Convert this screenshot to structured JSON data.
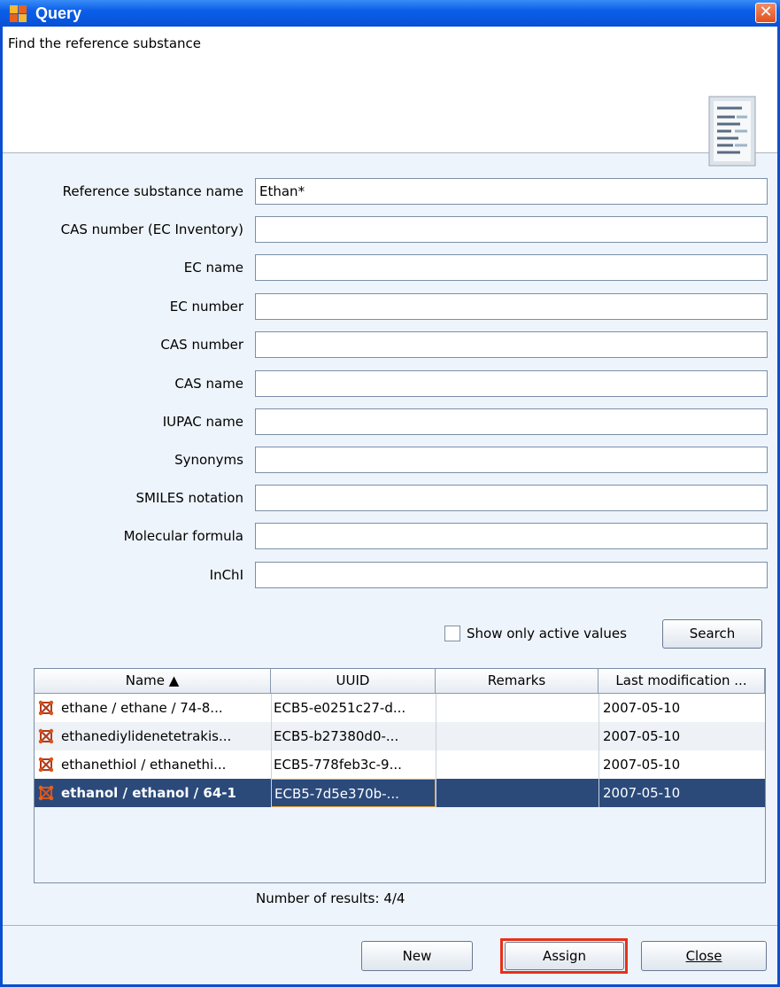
{
  "window": {
    "title": "Query",
    "close_label": "✕"
  },
  "header": {
    "text": "Find the reference substance"
  },
  "form": {
    "fields": [
      {
        "label": "Reference substance name",
        "value": "Ethan*"
      },
      {
        "label": "CAS number (EC Inventory)",
        "value": ""
      },
      {
        "label": "EC name",
        "value": ""
      },
      {
        "label": "EC number",
        "value": ""
      },
      {
        "label": "CAS number",
        "value": ""
      },
      {
        "label": "CAS name",
        "value": ""
      },
      {
        "label": "IUPAC name",
        "value": ""
      },
      {
        "label": "Synonyms",
        "value": ""
      },
      {
        "label": "SMILES notation",
        "value": ""
      },
      {
        "label": "Molecular formula",
        "value": ""
      },
      {
        "label": "InChI",
        "value": ""
      }
    ],
    "active_values_label": "Show only active values",
    "active_values_checked": false,
    "search_label": "Search"
  },
  "table": {
    "columns": [
      "Name ▲",
      "UUID",
      "Remarks",
      "Last modification ..."
    ],
    "rows": [
      {
        "name": "ethane / ethane / 74-8...",
        "uuid": "ECB5-e0251c27-d...",
        "remarks": "",
        "modified": "2007-05-10",
        "selected": false
      },
      {
        "name": "ethanediylidenetetrakis...",
        "uuid": "ECB5-b27380d0-...",
        "remarks": "",
        "modified": "2007-05-10",
        "selected": false
      },
      {
        "name": "ethanethiol / ethanethi...",
        "uuid": "ECB5-778feb3c-9...",
        "remarks": "",
        "modified": "2007-05-10",
        "selected": false
      },
      {
        "name": "ethanol / ethanol / 64-1",
        "uuid": "ECB5-7d5e370b-...",
        "remarks": "",
        "modified": "2007-05-10",
        "selected": true
      }
    ]
  },
  "results_text": "Number of results:  4/4",
  "footer": {
    "new_label": "New",
    "assign_label": "Assign",
    "close_label": "Close"
  },
  "colors": {
    "titlebar": "#0b5fe8",
    "selection": "#2b4a7a",
    "highlight_border": "#e8301a"
  }
}
